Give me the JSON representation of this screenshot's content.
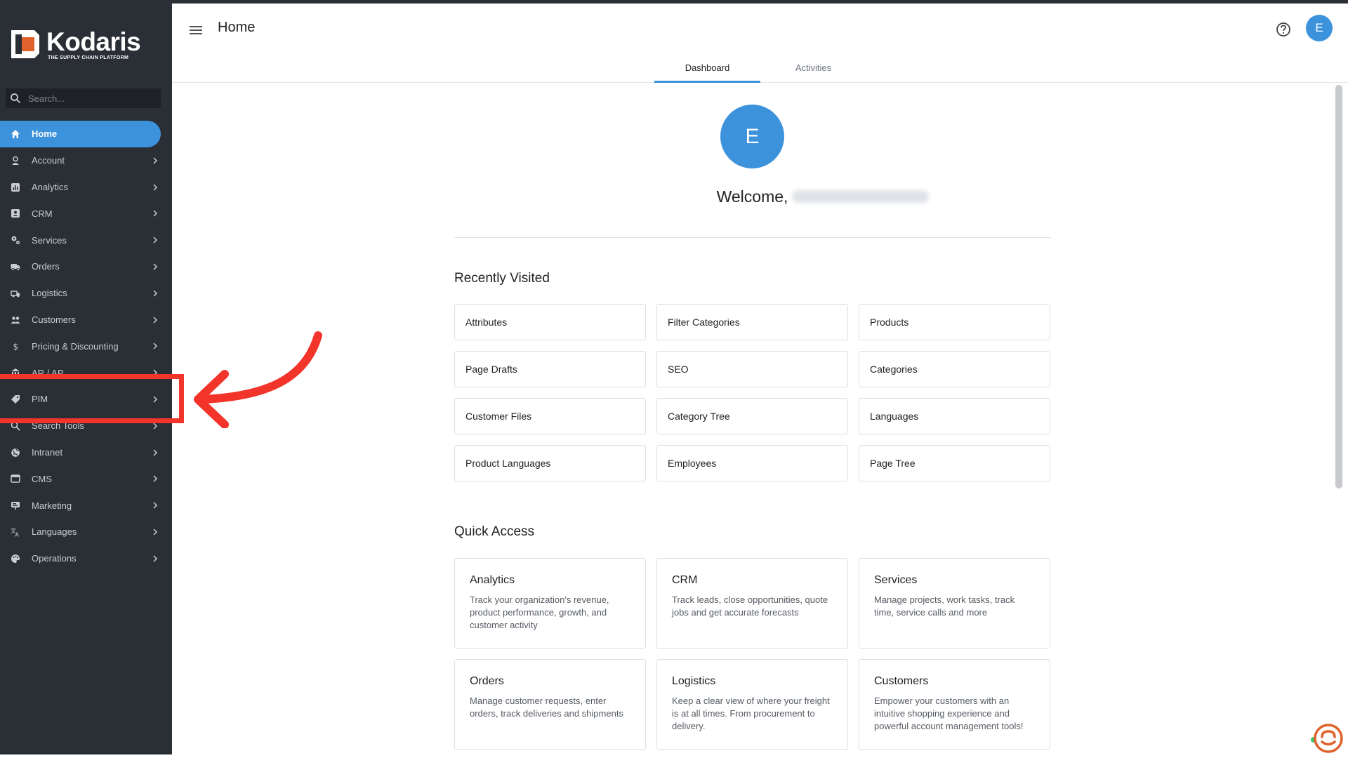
{
  "brand": {
    "name": "Kodaris",
    "tagline": "THE SUPPLY CHAIN PLATFORM",
    "accent": "#3d92dc"
  },
  "sidebar": {
    "search_placeholder": "Search...",
    "items": [
      {
        "label": "Home",
        "icon": "home-icon"
      },
      {
        "label": "Account",
        "icon": "person-icon"
      },
      {
        "label": "Analytics",
        "icon": "chart-icon"
      },
      {
        "label": "CRM",
        "icon": "contact-card-icon"
      },
      {
        "label": "Services",
        "icon": "gears-icon"
      },
      {
        "label": "Orders",
        "icon": "truck-icon"
      },
      {
        "label": "Logistics",
        "icon": "shipping-icon"
      },
      {
        "label": "Customers",
        "icon": "people-icon"
      },
      {
        "label": "Pricing & Discounting",
        "icon": "dollar-icon"
      },
      {
        "label": "AR / AP",
        "icon": "bank-icon"
      },
      {
        "label": "PIM",
        "icon": "tag-icon"
      },
      {
        "label": "Search Tools",
        "icon": "search-icon"
      },
      {
        "label": "Intranet",
        "icon": "globe-icon"
      },
      {
        "label": "CMS",
        "icon": "window-icon"
      },
      {
        "label": "Marketing",
        "icon": "billboard-icon"
      },
      {
        "label": "Languages",
        "icon": "translate-icon"
      },
      {
        "label": "Operations",
        "icon": "palette-icon"
      }
    ]
  },
  "header": {
    "title": "Home",
    "avatar_initial": "E",
    "tabs": [
      {
        "label": "Dashboard"
      },
      {
        "label": "Activities"
      }
    ]
  },
  "main": {
    "avatar_initial": "E",
    "welcome": "Welcome,",
    "recently_visited_title": "Recently Visited",
    "recently_visited": [
      "Attributes",
      "Filter Categories",
      "Products",
      "Page Drafts",
      "SEO",
      "Categories",
      "Customer Files",
      "Category Tree",
      "Languages",
      "Product Languages",
      "Employees",
      "Page Tree"
    ],
    "quick_access_title": "Quick Access",
    "quick_access": [
      {
        "title": "Analytics",
        "desc": "Track your organization's revenue, product performance, growth, and customer activity"
      },
      {
        "title": "CRM",
        "desc": "Track leads, close opportunities, quote jobs and get accurate forecasts"
      },
      {
        "title": "Services",
        "desc": "Manage projects, work tasks, track time, service calls and more"
      },
      {
        "title": "Orders",
        "desc": "Manage customer requests, enter orders, track deliveries and shipments"
      },
      {
        "title": "Logistics",
        "desc": "Keep a clear view of where your freight is at all times. From procurement to delivery."
      },
      {
        "title": "Customers",
        "desc": "Empower your customers with an intuitive shopping experience and powerful account management tools!"
      }
    ]
  },
  "annotation": {
    "color": "#f2342a",
    "target": "PIM"
  }
}
